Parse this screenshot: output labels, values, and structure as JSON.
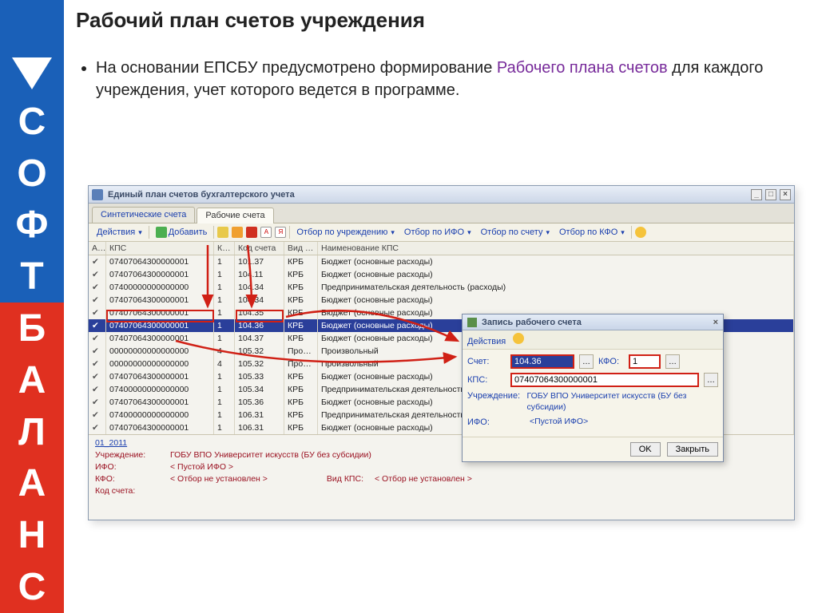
{
  "slide": {
    "heading": "Рабочий план счетов учреждения",
    "bullet_pre": "На основании ЕПСБУ предусмотрено формирование ",
    "bullet_hi": "Рабочего плана счетов",
    "bullet_post": " для каждого учреждения, учет которого ведется в программе."
  },
  "logo_chars": [
    "С",
    "О",
    "Ф",
    "Т",
    "Б",
    "А",
    "Л",
    "А",
    "Н",
    "С"
  ],
  "window": {
    "title": "Единый план счетов бухгалтерского учета",
    "tabs": {
      "synthetic": "Синтетические счета",
      "working": "Рабочие счета"
    }
  },
  "toolbar": {
    "actions": "Действия",
    "add": "Добавить",
    "filter_org": "Отбор по учреждению",
    "filter_ifo": "Отбор по ИФО",
    "filter_acct": "Отбор по счету",
    "filter_kfo": "Отбор по КФО"
  },
  "grid": {
    "headers": {
      "a": "А…",
      "kps": "КПС",
      "k": "К…",
      "code": "Код счета",
      "vid": "Вид …",
      "name": "Наименование КПС"
    },
    "rows": [
      {
        "kps": "07407064300000001",
        "k": "1",
        "code": "101.37",
        "vid": "КРБ",
        "name": "Бюджет (основные расходы)"
      },
      {
        "kps": "07407064300000001",
        "k": "1",
        "code": "104.11",
        "vid": "КРБ",
        "name": "Бюджет (основные расходы)"
      },
      {
        "kps": "07400000000000000",
        "k": "1",
        "code": "104.34",
        "vid": "КРБ",
        "name": "Предпринимательская деятельность (расходы)"
      },
      {
        "kps": "07407064300000001",
        "k": "1",
        "code": "104.34",
        "vid": "КРБ",
        "name": "Бюджет (основные расходы)"
      },
      {
        "kps": "07407064300000001",
        "k": "1",
        "code": "104.35",
        "vid": "КРБ",
        "name": "Бюджет (основные расходы)"
      },
      {
        "kps": "07407064300000001",
        "k": "1",
        "code": "104.36",
        "vid": "КРБ",
        "name": "Бюджет (основные расходы)"
      },
      {
        "kps": "07407064300000001",
        "k": "1",
        "code": "104.37",
        "vid": "КРБ",
        "name": "Бюджет (основные расходы)"
      },
      {
        "kps": "00000000000000000",
        "k": "4",
        "code": "105.32",
        "vid": "Про…",
        "name": "Произвольный"
      },
      {
        "kps": "00000000000000000",
        "k": "4",
        "code": "105.32",
        "vid": "Про…",
        "name": "Произвольный"
      },
      {
        "kps": "07407064300000001",
        "k": "1",
        "code": "105.33",
        "vid": "КРБ",
        "name": "Бюджет (основные расходы)"
      },
      {
        "kps": "07400000000000000",
        "k": "1",
        "code": "105.34",
        "vid": "КРБ",
        "name": "Предпринимательская деятельность (расходы)"
      },
      {
        "kps": "07407064300000001",
        "k": "1",
        "code": "105.36",
        "vid": "КРБ",
        "name": "Бюджет (основные расходы)"
      },
      {
        "kps": "07400000000000000",
        "k": "1",
        "code": "106.31",
        "vid": "КРБ",
        "name": "Предпринимательская деятельность (расходы)"
      },
      {
        "kps": "07407064300000001",
        "k": "1",
        "code": "106.31",
        "vid": "КРБ",
        "name": "Бюджет (основные расходы)"
      }
    ],
    "selected_index": 5
  },
  "footer": {
    "link": "01_2011",
    "org_label": "Учреждение:",
    "org_value": "ГОБУ ВПО Университет искусств (БУ без субсидии)",
    "ifo_label": "ИФО:",
    "ifo_value": "< Пустой ИФО >",
    "kfo_label": "КФО:",
    "kfo_value": "< Отбор не установлен >",
    "vidkps_label": "Вид КПС:",
    "vidkps_value": "< Отбор не установлен >",
    "code_label": "Код счета:"
  },
  "popup": {
    "title": "Запись рабочего счета",
    "actions": "Действия",
    "account_label": "Счет:",
    "account_value": "104.36",
    "kfo_label": "КФО:",
    "kfo_value": "1",
    "kps_label": "КПС:",
    "kps_value": "07407064300000001",
    "org_label": "Учреждение:",
    "org_value": "ГОБУ ВПО Университет искусств (БУ без субсидии)",
    "ifo_label": "ИФО:",
    "ifo_value": "<Пустой ИФО>",
    "ok": "OK",
    "close": "Закрыть"
  }
}
